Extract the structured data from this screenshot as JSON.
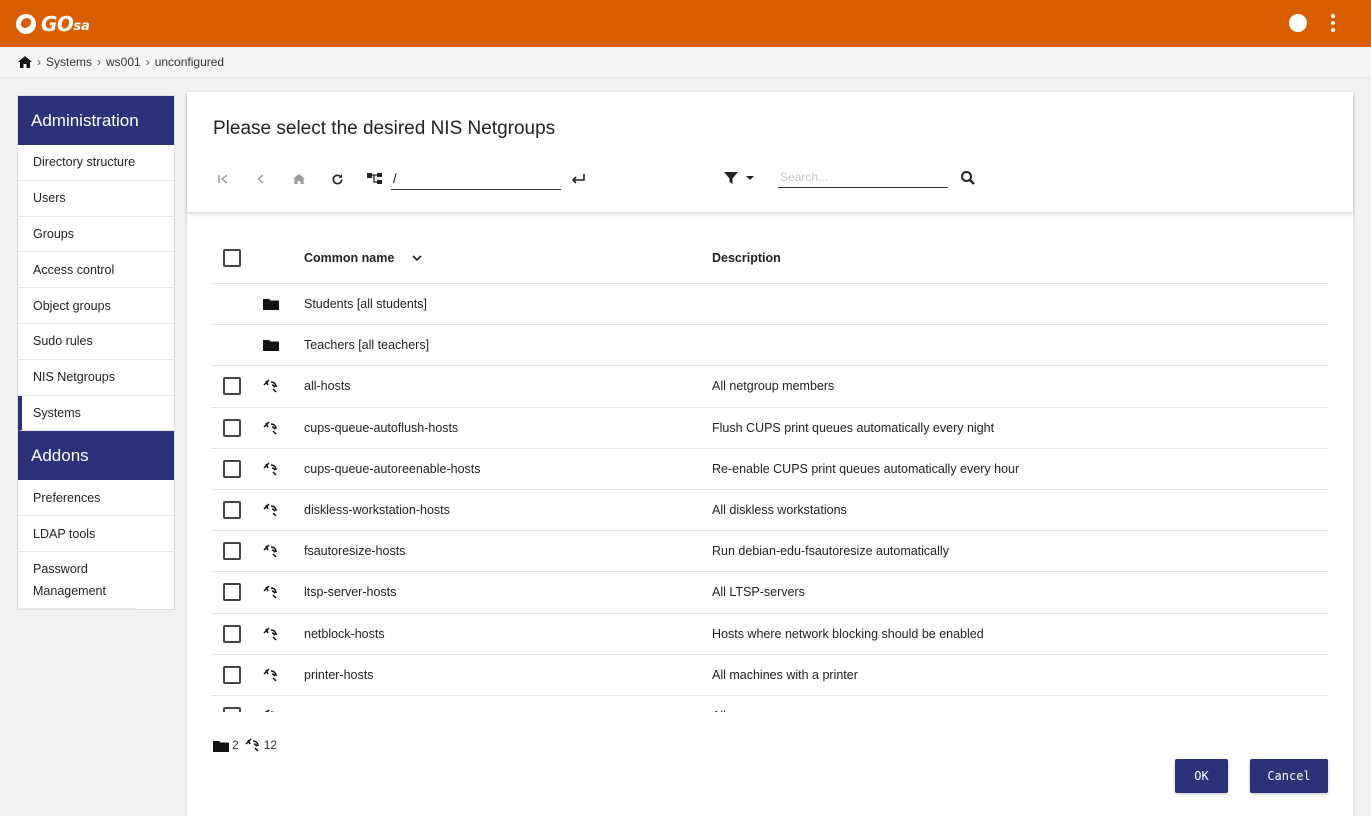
{
  "app": {
    "logo_main": "GO",
    "logo_sub": "sa"
  },
  "breadcrumb": [
    "Systems",
    "ws001",
    "unconfigured"
  ],
  "sidebar": {
    "sections": [
      {
        "title": "Administration",
        "items": [
          {
            "label": "Directory structure"
          },
          {
            "label": "Users"
          },
          {
            "label": "Groups"
          },
          {
            "label": "Access control"
          },
          {
            "label": "Object groups"
          },
          {
            "label": "Sudo rules"
          },
          {
            "label": "NIS Netgroups"
          },
          {
            "label": "Systems",
            "active": true
          }
        ]
      },
      {
        "title": "Addons",
        "items": [
          {
            "label": "Preferences"
          },
          {
            "label": "LDAP tools"
          },
          {
            "label": "Password Management"
          }
        ]
      }
    ]
  },
  "panel": {
    "title": "Please select the desired NIS Netgroups",
    "base_value": "/",
    "search_placeholder": "Search..."
  },
  "table": {
    "columns": {
      "name": "Common name",
      "description": "Description"
    },
    "rows": [
      {
        "type": "folder",
        "name": "Students [all students]",
        "description": ""
      },
      {
        "type": "folder",
        "name": "Teachers [all teachers]",
        "description": ""
      },
      {
        "type": "netgroup",
        "name": "all-hosts",
        "description": "All netgroup members"
      },
      {
        "type": "netgroup",
        "name": "cups-queue-autoflush-hosts",
        "description": "Flush CUPS print queues automatically every night"
      },
      {
        "type": "netgroup",
        "name": "cups-queue-autoreenable-hosts",
        "description": "Re-enable CUPS print queues automatically every hour"
      },
      {
        "type": "netgroup",
        "name": "diskless-workstation-hosts",
        "description": "All diskless workstations"
      },
      {
        "type": "netgroup",
        "name": "fsautoresize-hosts",
        "description": "Run debian-edu-fsautoresize automatically"
      },
      {
        "type": "netgroup",
        "name": "ltsp-server-hosts",
        "description": "All LTSP-servers"
      },
      {
        "type": "netgroup",
        "name": "netblock-hosts",
        "description": "Hosts where network blocking should be enabled"
      },
      {
        "type": "netgroup",
        "name": "printer-hosts",
        "description": "All machines with a printer"
      },
      {
        "type": "netgroup",
        "name": "",
        "description": "All"
      }
    ]
  },
  "summary": {
    "folders": "2",
    "netgroups": "12"
  },
  "buttons": {
    "ok": "OK",
    "cancel": "Cancel"
  },
  "colors": {
    "topbar": "#d85e00",
    "accent": "#2c327a"
  }
}
